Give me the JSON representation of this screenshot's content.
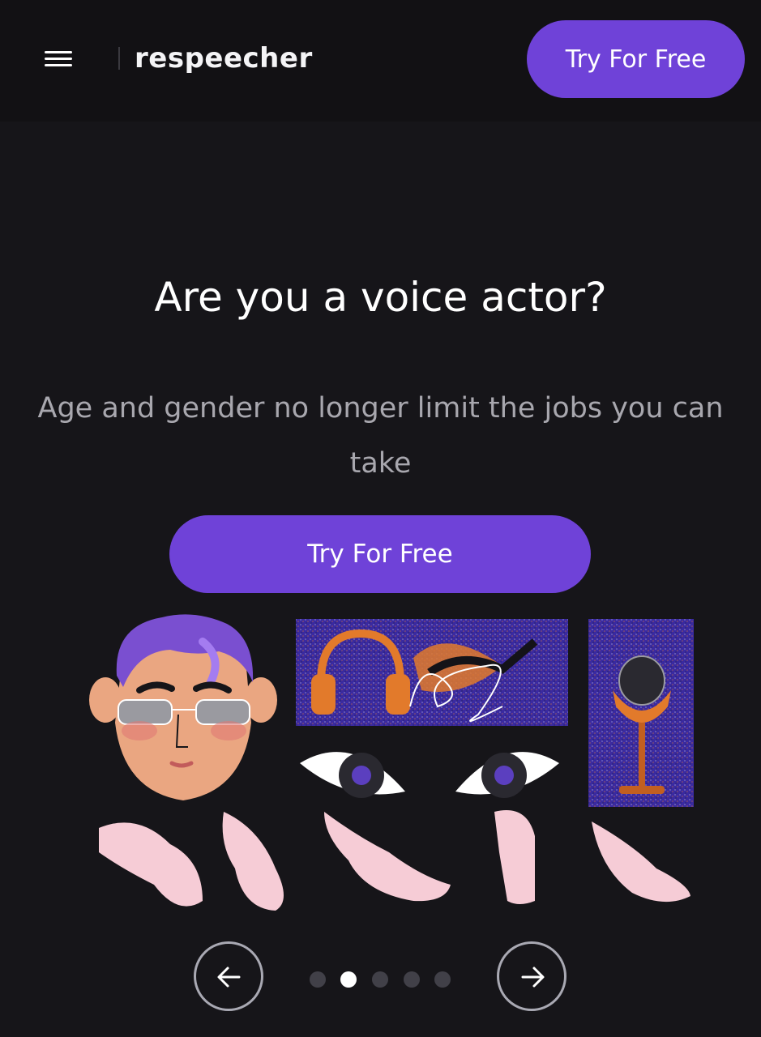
{
  "header": {
    "brand": "respeecher",
    "cta_label": "Try For Free"
  },
  "hero": {
    "title": "Are you a voice actor?",
    "subtitle": "Age and gender no longer limit the jobs you can take",
    "cta_label": "Try For Free"
  },
  "carousel": {
    "active_slide": 2,
    "total_slides": 5
  },
  "colors": {
    "accent": "#6f42d8",
    "background": "#161519",
    "header_bg": "#121114",
    "subtitle_text": "#a8a7ae"
  },
  "icons": [
    "hamburger-menu-icon",
    "arrow-left-icon",
    "arrow-right-icon"
  ]
}
